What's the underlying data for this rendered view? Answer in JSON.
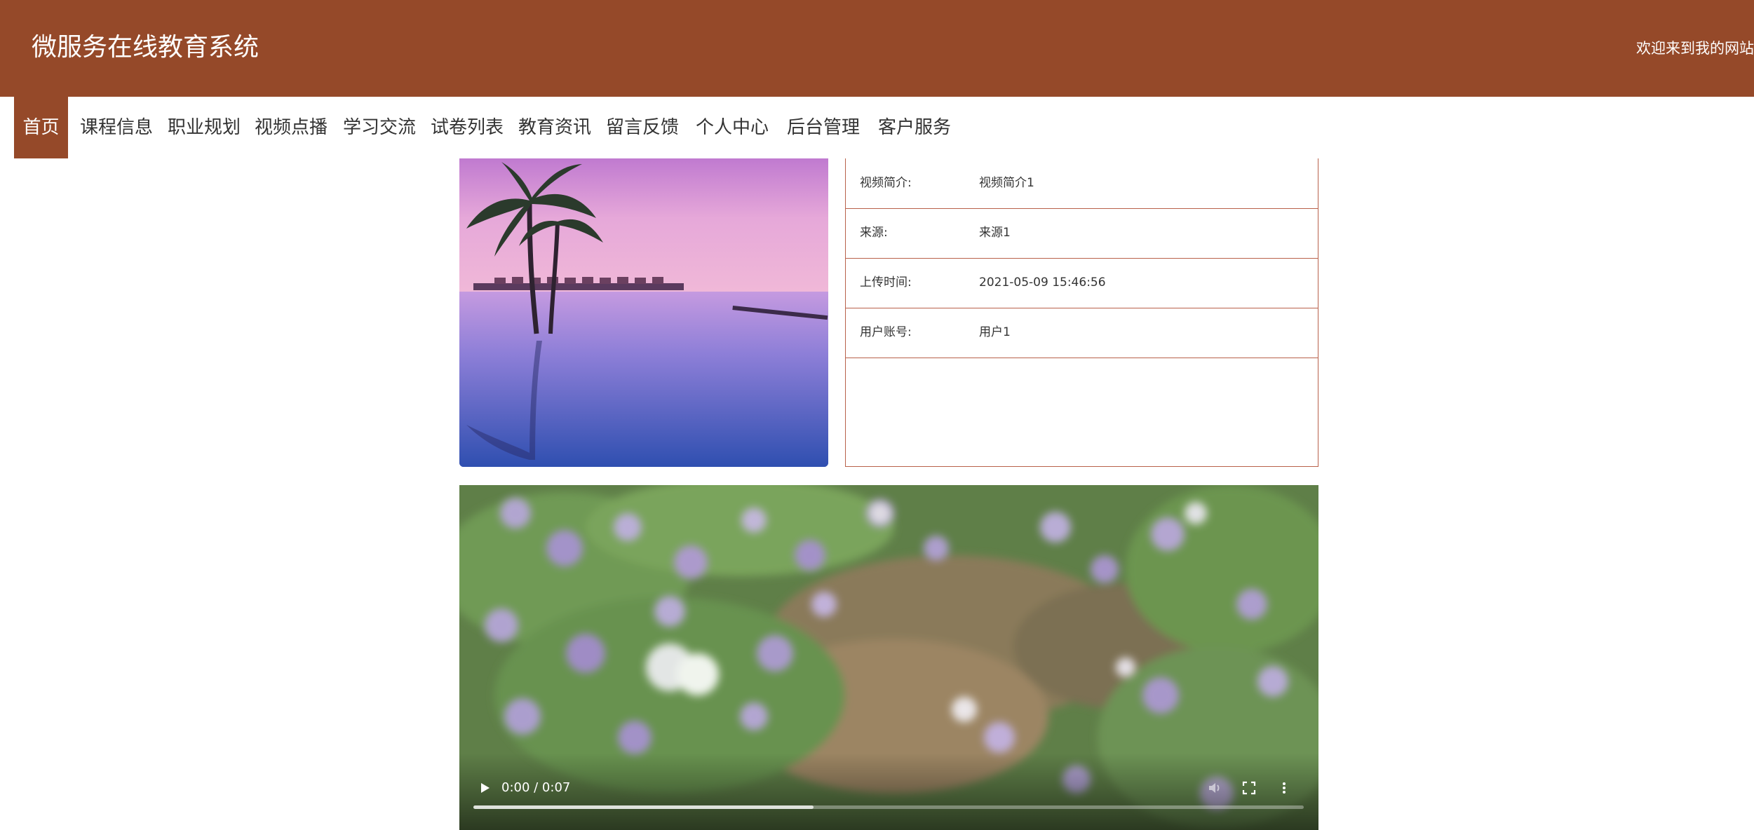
{
  "header": {
    "site_title": "微服务在线教育系统",
    "welcome": "欢迎来到我的网站",
    "bg_color": "#954929"
  },
  "nav": {
    "items": [
      {
        "label": "首页",
        "active": true
      },
      {
        "label": "课程信息"
      },
      {
        "label": "职业规划"
      },
      {
        "label": "视频点播"
      },
      {
        "label": "学习交流"
      },
      {
        "label": "试卷列表"
      },
      {
        "label": "教育资讯"
      },
      {
        "label": "留言反馈"
      },
      {
        "label": "个人中心"
      },
      {
        "label": "后台管理"
      },
      {
        "label": "客户服务"
      }
    ]
  },
  "detail": {
    "rows": [
      {
        "label": "视频简介:",
        "value": "视频简介1"
      },
      {
        "label": "来源:",
        "value": "来源1"
      },
      {
        "label": "上传时间:",
        "value": "2021-05-09 15:46:56"
      },
      {
        "label": "用户账号:",
        "value": "用户1"
      }
    ],
    "border_color": "#b8614a"
  },
  "video": {
    "time_display": "0:00 / 0:07",
    "buffered_fraction": 0.41,
    "played_fraction": 0.0
  }
}
